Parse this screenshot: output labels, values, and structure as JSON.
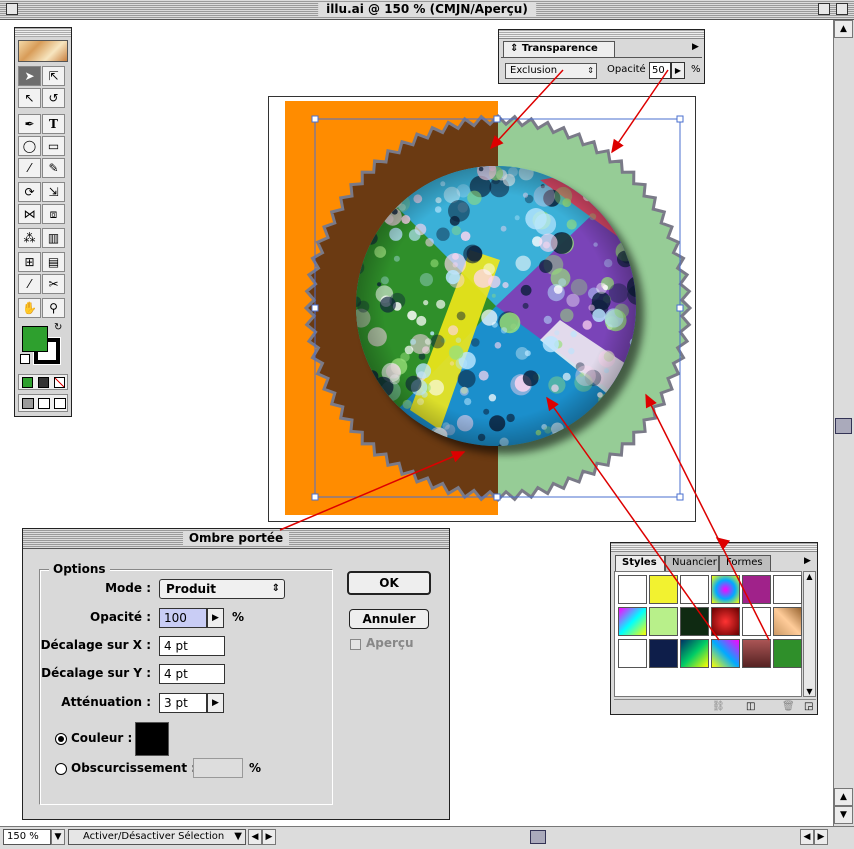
{
  "window": {
    "title": "illu.ai @ 150 % (CMJN/Aperçu)"
  },
  "statusbar": {
    "zoom": "150 %",
    "action": "Activer/Désactiver Sélection"
  },
  "transparency_panel": {
    "tab": "Transparence",
    "mode": "Exclusion",
    "opacity_label": "Opacité :",
    "opacity_value": "50",
    "percent": "%"
  },
  "drop_shadow_dialog": {
    "title": "Ombre portée",
    "group_label": "Options",
    "mode_label": "Mode :",
    "mode_value": "Produit",
    "opacity_label": "Opacité :",
    "opacity_value": "100",
    "percent": "%",
    "x_offset_label": "Décalage sur X :",
    "x_offset_value": "4 pt",
    "y_offset_label": "Décalage sur Y :",
    "y_offset_value": "4 pt",
    "blur_label": "Atténuation :",
    "blur_value": "3 pt",
    "color_label": "Couleur :",
    "darkness_label": "Obscurcissement :",
    "darkness_percent": "%",
    "ok_label": "OK",
    "cancel_label": "Annuler",
    "preview_label": "Aperçu",
    "shadow_color": "#000000"
  },
  "styles_panel": {
    "tabs": [
      "Styles",
      "Nuancier",
      "Formes"
    ]
  },
  "colors": {
    "fill": "#2ea02e",
    "orange": "#ff8c00",
    "brown": "#6b3a12",
    "mint": "#96cc96",
    "arrow": "#dd0000"
  }
}
